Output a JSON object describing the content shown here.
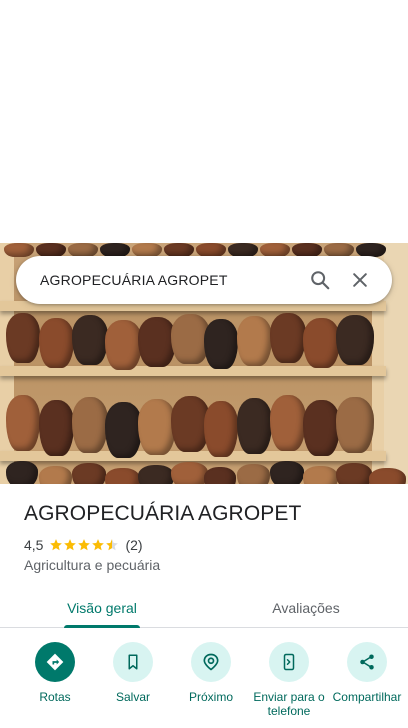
{
  "search": {
    "query": "AGROPECUÁRIA AGROPET",
    "search_icon": "search-icon",
    "close_icon": "close-icon"
  },
  "place": {
    "name": "AGROPECUÁRIA AGROPET",
    "rating": "4,5",
    "rating_value": 4.5,
    "review_count": "(2)",
    "category": "Agricultura e pecuária"
  },
  "tabs": [
    {
      "label": "Visão geral",
      "active": true
    },
    {
      "label": "Avaliações",
      "active": false
    }
  ],
  "actions": [
    {
      "label": "Rotas",
      "icon": "directions-icon"
    },
    {
      "label": "Salvar",
      "icon": "bookmark-icon"
    },
    {
      "label": "Próximo",
      "icon": "nearby-icon"
    },
    {
      "label": "Enviar para o telefone",
      "icon": "send-to-phone-icon"
    },
    {
      "label": "Compartilhar",
      "icon": "share-icon"
    }
  ],
  "colors": {
    "accent": "#00796b",
    "action_bg": "#d8f4f1",
    "star": "#fbbc04"
  }
}
